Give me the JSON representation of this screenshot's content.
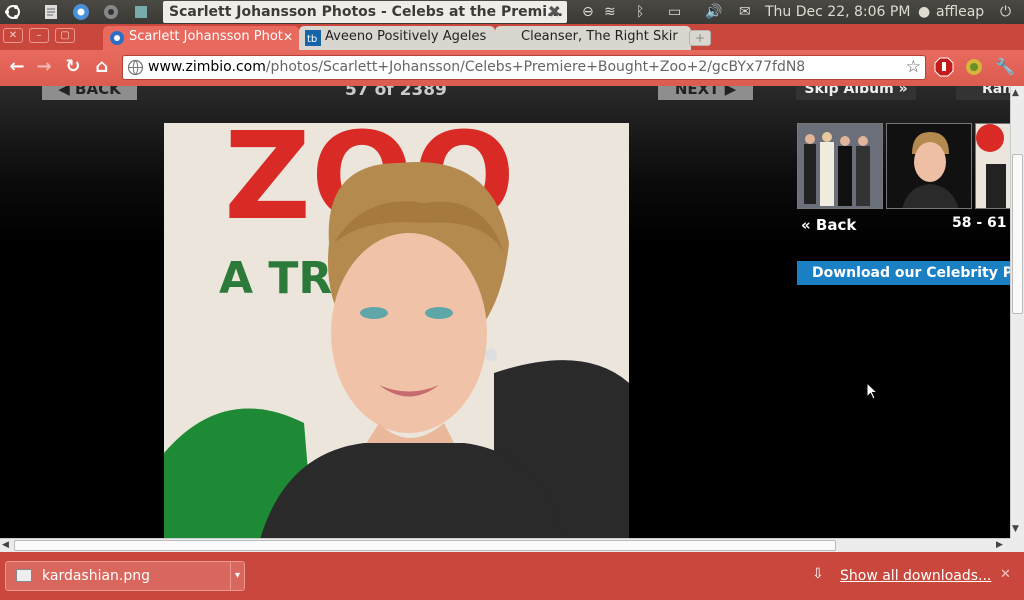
{
  "panel": {
    "window_title": "Scarlett Johansson Photos - Celebs at the Premi...",
    "datetime": "Thu Dec 22,  8:06 PM",
    "user": "affleap"
  },
  "tabs": [
    {
      "label": "Scarlett Johansson Phot",
      "active": true
    },
    {
      "label": "Aveeno Positively Ageles",
      "active": false
    },
    {
      "label": "Cleanser, The Right Skir",
      "active": false
    }
  ],
  "toolbar": {
    "url_host": "www.zimbio.com",
    "url_path": "/photos/Scarlett+Johansson/Celebs+Premiere+Bought+Zoo+2/gcBYx77fdN8"
  },
  "page": {
    "back_label": "BACK",
    "next_label": "NEXT",
    "counter": "57  of  2389",
    "skip_label": "Skip Album »",
    "random_label": "Ran",
    "thumbs_back": "« Back",
    "thumbs_range": "58 - 61",
    "download_banner": "Download our Celebrity Pictu",
    "photo_sign_main": "ZOO",
    "photo_sign_sub": "A TRU   STO"
  },
  "downloads": {
    "item_name": "kardashian.png",
    "show_all": "Show all downloads..."
  },
  "colors": {
    "accent_red": "#c9473c",
    "download_blue": "#1b7fc4"
  }
}
